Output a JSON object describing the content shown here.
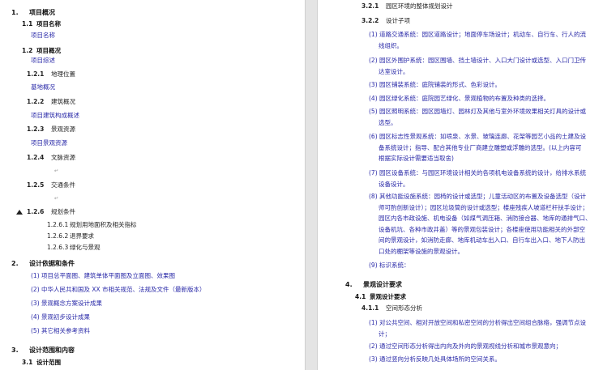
{
  "left": {
    "s1": {
      "num": "1.",
      "title": "项目概况"
    },
    "s1_1": {
      "num": "1.1",
      "title": "项目名称",
      "body": "项目名称"
    },
    "s1_2": {
      "num": "1.2",
      "title": "项目概况",
      "body": "项目综述"
    },
    "s1_2_1": {
      "num": "1.2.1",
      "title": "地理位置",
      "body": "基地概况"
    },
    "s1_2_2": {
      "num": "1.2.2",
      "title": "建筑概况",
      "body": "项目建筑构成概述"
    },
    "s1_2_3": {
      "num": "1.2.3",
      "title": "景观资源",
      "body": "项目景观资源"
    },
    "s1_2_4": {
      "num": "1.2.4",
      "title": "文脉资源"
    },
    "s1_2_5": {
      "num": "1.2.5",
      "title": "交通条件"
    },
    "s1_2_6": {
      "num": "1.2.6",
      "title": "规划条件"
    },
    "s1_2_6_items": [
      {
        "num": "1.2.6.1",
        "text": "规划用地面积及相关指标"
      },
      {
        "num": "1.2.6.2",
        "text": "退界要求"
      },
      {
        "num": "1.2.6.3",
        "text": "绿化与景观"
      }
    ],
    "s2": {
      "num": "2.",
      "title": "设计依据和条件"
    },
    "s2_items": [
      "(1) 项目总平面图、建筑单体平面图及立面图、效果图",
      "(2) 中华人民共和国及 XX 市相关规范、法规及文件（最新版本）",
      "(3) 景观概念方案设计成果",
      "(4) 景观初步设计成果",
      "(5) 其它相关参考资料"
    ],
    "s3": {
      "num": "3.",
      "title": "设计范围和内容"
    },
    "s3_1": {
      "num": "3.1",
      "title": "设计范围"
    }
  },
  "right": {
    "s3_2_1": {
      "num": "3.2.1",
      "title": "园区环境的整体规划设计"
    },
    "s3_2_2": {
      "num": "3.2.2",
      "title": "设计子项"
    },
    "items": [
      {
        "lines": [
          "(1) 道路交通系统：园区道路设计；地面停车场设计；机动车、自行车、行人的流",
          "线组织。"
        ]
      },
      {
        "lines": [
          "(2) 园区外围护系统：园区围墙、挡土墙设计、入口大门设计或选型、入口门卫传",
          "达室设计。"
        ]
      },
      {
        "lines": [
          "(3) 园区铺装系统：庭院铺装的形式、色彩设计。"
        ]
      },
      {
        "lines": [
          "(4) 园区绿化系统：庭院园艺绿化、景观植物的布置及种类的选择。"
        ]
      },
      {
        "lines": [
          "(5) 园区照明系统：园区园墙灯、园林灯及其他与室外环境效果相关灯具的设计或",
          "选型。"
        ]
      },
      {
        "lines": [
          "(6) 园区标志性景观系统：如喷泉、水景、玻璃连廊、花架等园艺小品的土建及设",
          "备系统设计；指导、配合其他专业厂商建立雕塑或浮雕的选型。(以上内容可",
          "根据实际设计需要适当取舍)"
        ]
      },
      {
        "lines": [
          "(7) 园区设备系统：与园区环境设计相关的各项机电设备系统的设计，给排水系统",
          "设备设计。"
        ]
      },
      {
        "lines": [
          "(8) 其他功能设施系统：园椅的设计或选型；儿童活动区的布置及设备选型（设计",
          "师可酌创新设计）；园区垃圾筒的设计或选型；楼座残疾人坡道栏杆扶手设计；",
          "园区内各市政设施、机电设备（如煤气调压箱、消防接合器、地库的通排气口、",
          "设备机坑、各种市政井盖）等的景观包装设计；各楼座使用功能相关的外部空",
          "间的景观设计，如消防走廊、地库机动车出入口、自行车出入口、地下人防出",
          "口处的棚架等设施的景观设计。"
        ]
      },
      {
        "lines": [
          "(9) 标识系统："
        ]
      }
    ],
    "s4": {
      "num": "4.",
      "title": "景观设计要求"
    },
    "s4_1": {
      "num": "4.1",
      "title": "景观设计要求"
    },
    "s4_1_1": {
      "num": "4.1.1",
      "title": "空间形态分析"
    },
    "s4_items": [
      {
        "lines": [
          "(1) 对公共空间、相对开放空间和私密空间的分析得出空间组合脉络，强调节点设",
          "计；"
        ]
      },
      {
        "lines": [
          "(2) 通过空间形态分析得出内向及外向的景观视线分析和城市景观意向；"
        ]
      },
      {
        "lines": [
          "(3) 通过竖向分析反映几处具体场所的空间关系。"
        ]
      }
    ]
  }
}
